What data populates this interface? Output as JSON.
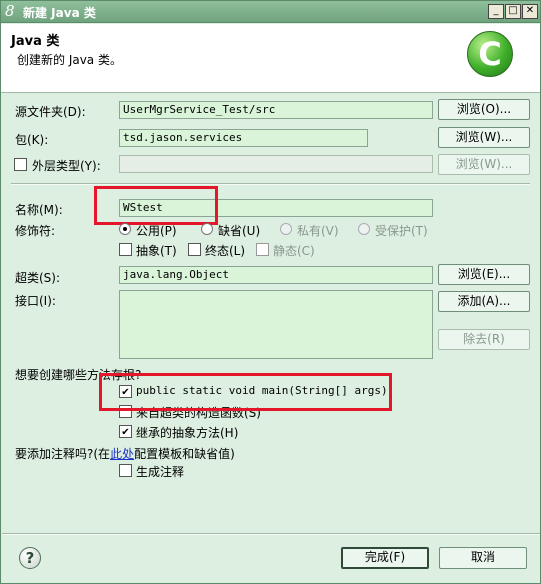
{
  "window": {
    "title": "新建 Java 类",
    "icon": "eclipse-8-icon",
    "controls": {
      "minimize": "_",
      "maximize": "□",
      "close": "✕"
    }
  },
  "header": {
    "title": "Java 类",
    "subtitle": "创建新的 Java 类。",
    "logo_letter": "C"
  },
  "form": {
    "source_folder": {
      "label": "源文件夹(D):",
      "value": "UserMgrService_Test/src",
      "button": "浏览(O)..."
    },
    "package": {
      "label": "包(K):",
      "value": "tsd.jason.services",
      "button": "浏览(W)..."
    },
    "enclosing_type": {
      "label": "外层类型(Y):",
      "checked": false,
      "value": "",
      "button": "浏览(W)..."
    },
    "name": {
      "label": "名称(M):",
      "value": "WStest"
    },
    "modifiers": {
      "label": "修饰符:",
      "radios": [
        {
          "label": "公用(P)",
          "selected": true,
          "enabled": true
        },
        {
          "label": "缺省(U)",
          "selected": false,
          "enabled": true
        },
        {
          "label": "私有(V)",
          "selected": false,
          "enabled": false
        },
        {
          "label": "受保护(T)",
          "selected": false,
          "enabled": false
        }
      ],
      "checks": [
        {
          "label": "抽象(T)",
          "checked": false,
          "enabled": true
        },
        {
          "label": "终态(L)",
          "checked": false,
          "enabled": true
        },
        {
          "label": "静态(C)",
          "checked": false,
          "enabled": false
        }
      ]
    },
    "superclass": {
      "label": "超类(S):",
      "value": "java.lang.Object",
      "button": "浏览(E)..."
    },
    "interfaces": {
      "label": "接口(I):",
      "add_button": "添加(A)...",
      "remove_button": "除去(R)"
    },
    "stubs": {
      "question": "想要创建哪些方法存根?",
      "options": [
        {
          "label": "public static void main(String[] args)",
          "checked": true
        },
        {
          "label": "来自超类的构造函数(S)",
          "checked": false
        },
        {
          "label": "继承的抽象方法(H)",
          "checked": true
        }
      ]
    },
    "comments": {
      "question_prefix": "要添加注释吗?(在",
      "link": "此处",
      "question_suffix": "配置模板和缺省值)",
      "option": {
        "label": "生成注释",
        "checked": false
      }
    }
  },
  "footer": {
    "help": "?",
    "finish": "完成(F)",
    "cancel": "取消"
  }
}
